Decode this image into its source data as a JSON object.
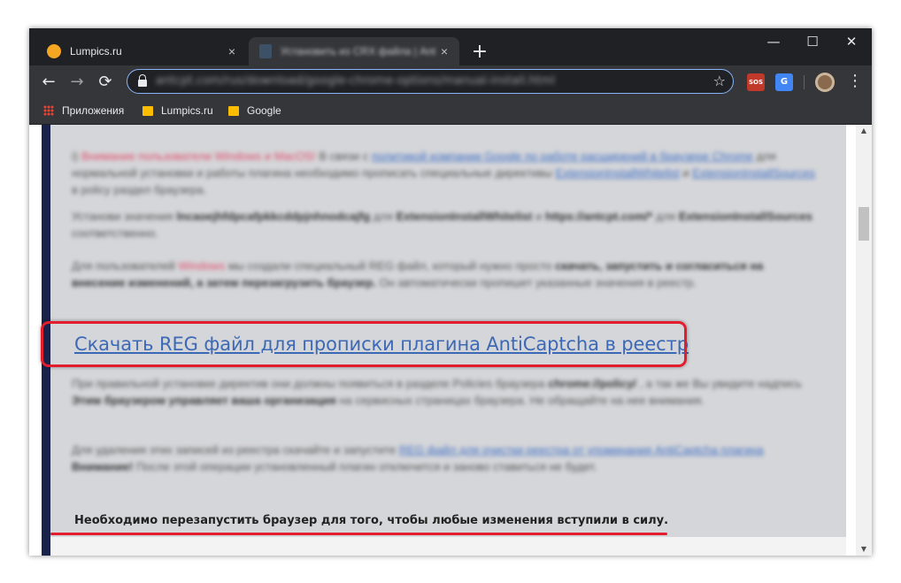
{
  "tabs": [
    {
      "title": "Lumpics.ru",
      "close": "×"
    },
    {
      "title": "Установить из CRX файла | AntiCaptcha",
      "close": "×"
    }
  ],
  "new_tab": "+",
  "window_controls": {
    "minimize": "—",
    "maximize": "☐",
    "close": "✕"
  },
  "toolbar": {
    "back": "←",
    "forward": "→",
    "reload": "⟳",
    "url": "antcpt.com/rus/download/google-chrome-options/manual-install.html",
    "star": "☆",
    "ext_sos": "SOS",
    "ext_translate": "G",
    "menu": "⋮"
  },
  "bookmarks": [
    {
      "label": "Приложения"
    },
    {
      "label": "Lumpics.ru"
    },
    {
      "label": "Google"
    }
  ],
  "article": {
    "para1_warn": "Внимание пользователи Windows и MacOS!",
    "para1_a": "В связи с",
    "para1_link1": "политикой компании Google по работе расширений в браузере Chrome",
    "para1_b": "для нормальной установки и работы плагина необходимо прописать специальные директивы",
    "para1_link2": "ExtensionInstallWhitelist",
    "para1_c": "и",
    "para1_link3": "ExtensionInstallSources",
    "para1_d": "в policy раздел браузера.",
    "para2_a": "Установи значения",
    "para2_b": "lncaoejhfdpcafpkkcddpjnhnodcajfg",
    "para2_c": "для",
    "para2_d": "ExtensionInstallWhitelist",
    "para2_e": "и",
    "para2_f": "https://antcpt.com/*",
    "para2_g": "для",
    "para2_h": "ExtensionInstallSources",
    "para2_i": "соответственно.",
    "para3_a": "Для пользователей",
    "para3_win": "Windows",
    "para3_b": "мы создали специальный REG файл, который нужно просто",
    "para3_bold": "скачать, запустить и согласиться на внесение изменений, а затем перезагрузить браузер.",
    "para3_c": "Он автоматически пропишет указанные значения в реестр.",
    "download_link": "Скачать REG файл для прописки плагина AntiCaptcha в реестр",
    "para4_a": "При правильной установке директив они должны появиться в разделе Policies браузера",
    "para4_bold1": "chrome://policy/",
    "para4_b": ", а так же Вы увидите надпись",
    "para4_bold2": "Этим браузером управляет ваша организация",
    "para4_c": "на сервисных страницах браузера. Не обращайте на нее внимания.",
    "para5_a": "Для удаления этих записей из реестра скачайте и запустите",
    "para5_link": "REG файл для очистки реестра от упоминания AntiCaptcha плагина",
    "para5_bold": "Внимание!",
    "para5_b": "После этой операции установленный плагин отключится и заново ставиться не будет.",
    "restart_note": "Необходимо перезапустить браузер для того, чтобы любые изменения вступили в силу."
  },
  "scrollbar": {
    "up": "▲",
    "down": "▼"
  }
}
